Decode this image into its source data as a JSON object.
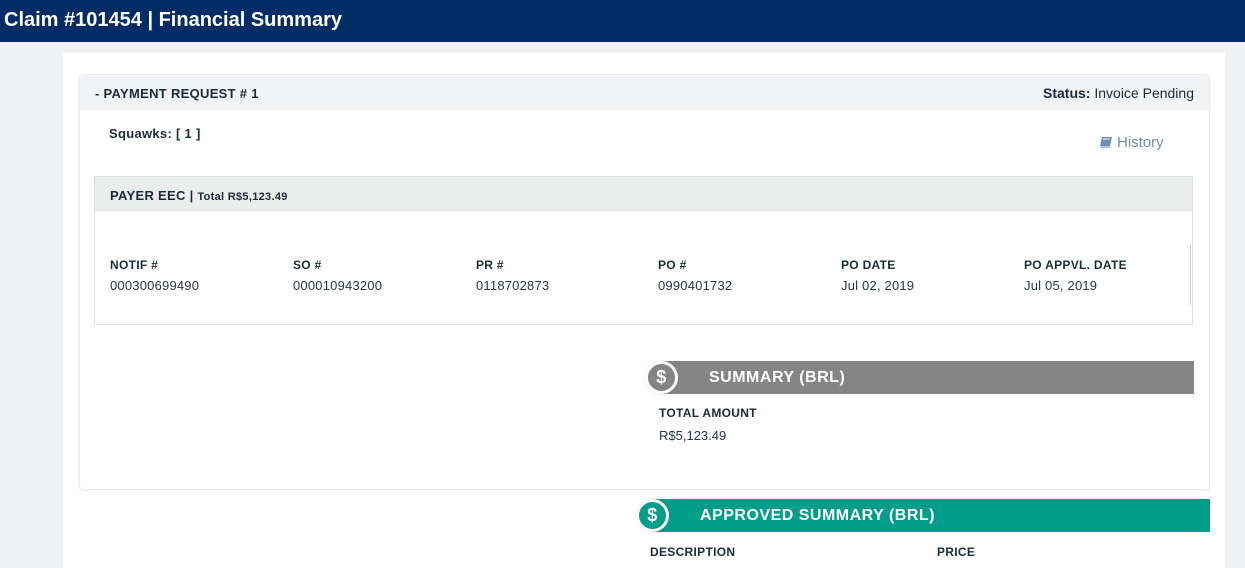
{
  "titlebar": {
    "title": "Claim #101454 | Financial Summary"
  },
  "payment_request": {
    "title": "- PAYMENT REQUEST # 1",
    "status_label": "Status:",
    "status_value": "Invoice Pending",
    "squawks": "Squawks: [ 1 ]",
    "history_link": "History",
    "history_icon": "book-icon"
  },
  "payer": {
    "name": "PAYER EEC |",
    "total": "Total R$5,123.49",
    "columns": [
      {
        "header": "NOTIF #",
        "value": "000300699490"
      },
      {
        "header": "SO #",
        "value": "000010943200"
      },
      {
        "header": "PR #",
        "value": "0118702873"
      },
      {
        "header": "PO #",
        "value": "0990401732"
      },
      {
        "header": "PO DATE",
        "value": "Jul 02, 2019"
      },
      {
        "header": "PO APPVL. DATE",
        "value": "Jul 05, 2019"
      }
    ]
  },
  "summary": {
    "title": "SUMMARY (BRL)",
    "icon": "dollar-icon",
    "total_label": "TOTAL AMOUNT",
    "total_value": "R$5,123.49",
    "color": "#858585"
  },
  "approved_summary": {
    "title": "APPROVED SUMMARY (BRL)",
    "icon": "dollar-icon",
    "col_description": "DESCRIPTION",
    "col_price": "PRICE",
    "color": "#009e8a"
  },
  "colors": {
    "header_bg": "#022c65",
    "link": "#6f8fb0"
  }
}
